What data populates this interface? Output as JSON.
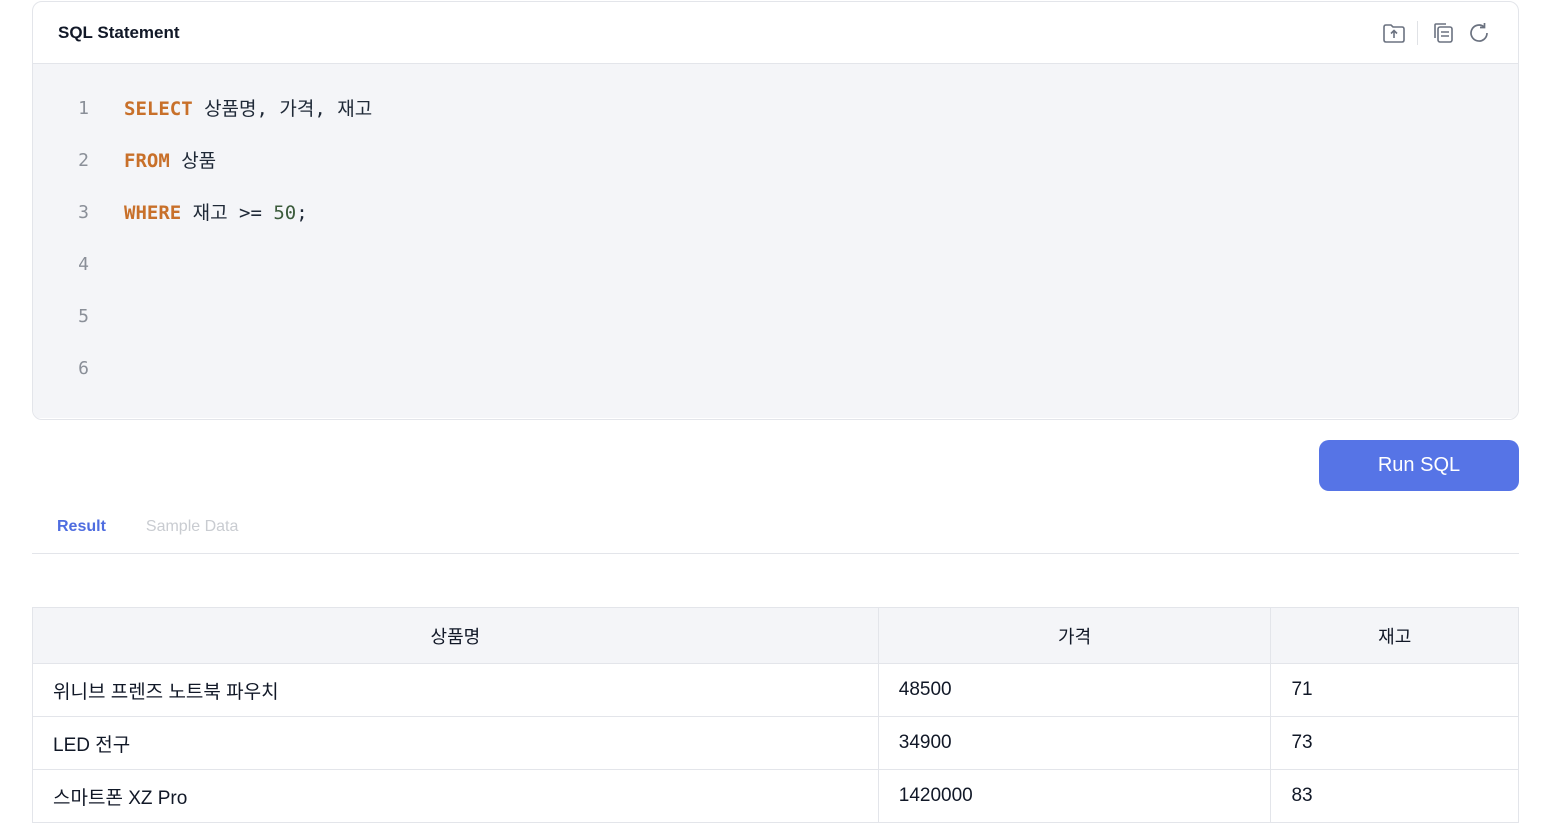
{
  "editor": {
    "title": "SQL Statement",
    "toolbar": {
      "upload_icon": "upload-file-icon",
      "copy_icon": "copy-icon",
      "reset_icon": "refresh-icon"
    },
    "lines": [
      {
        "no": "1",
        "tokens": [
          {
            "t": "SELECT",
            "k": "kw"
          },
          {
            "t": " 상품명, 가격, 재고",
            "k": "plain"
          }
        ]
      },
      {
        "no": "2",
        "tokens": [
          {
            "t": "FROM",
            "k": "kw"
          },
          {
            "t": " 상품",
            "k": "plain"
          }
        ]
      },
      {
        "no": "3",
        "tokens": [
          {
            "t": "WHERE",
            "k": "kw"
          },
          {
            "t": " 재고 >= ",
            "k": "plain"
          },
          {
            "t": "50",
            "k": "num"
          },
          {
            "t": ";",
            "k": "plain"
          }
        ]
      },
      {
        "no": "4",
        "tokens": []
      },
      {
        "no": "5",
        "tokens": []
      },
      {
        "no": "6",
        "tokens": []
      }
    ]
  },
  "run_button": {
    "label": "Run SQL"
  },
  "tabs": [
    {
      "label": "Result",
      "active": true
    },
    {
      "label": "Sample Data",
      "active": false
    }
  ],
  "result": {
    "columns": [
      "상품명",
      "가격",
      "재고"
    ],
    "rows": [
      [
        "위니브 프렌즈 노트북 파우치",
        "48500",
        "71"
      ],
      [
        "LED 전구",
        "34900",
        "73"
      ],
      [
        "스마트폰 XZ Pro",
        "1420000",
        "83"
      ]
    ]
  },
  "colors": {
    "accent": "#5674e6",
    "keyword": "#c8702a",
    "number": "#3b5b3b"
  }
}
